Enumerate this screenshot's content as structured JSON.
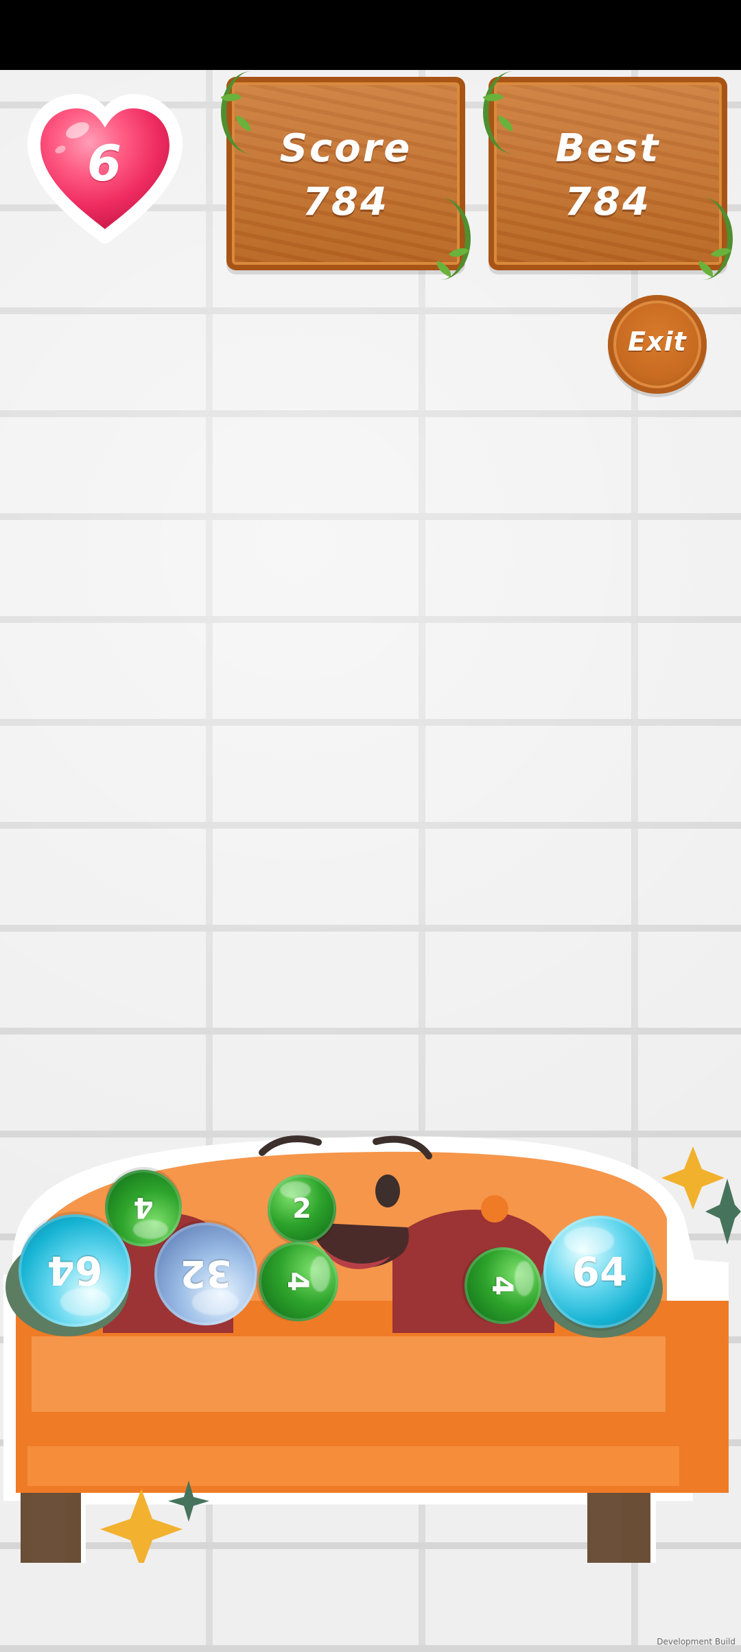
{
  "status_bar": {
    "color": "#000000"
  },
  "hud": {
    "lives": "6",
    "score_label": "Score",
    "score_value": "784",
    "best_label": "Best",
    "best_value": "784",
    "exit_label": "Exit"
  },
  "balls": [
    {
      "value": "4",
      "type": "green",
      "rotation_deg": 180
    },
    {
      "value": "2",
      "type": "green",
      "rotation_deg": 0
    },
    {
      "value": "64",
      "type": "cyan",
      "rotation_deg": 180
    },
    {
      "value": "32",
      "type": "blue",
      "rotation_deg": 180
    },
    {
      "value": "4",
      "type": "green",
      "rotation_deg": 90
    },
    {
      "value": "4",
      "type": "green",
      "rotation_deg": 90
    },
    {
      "value": "64",
      "type": "cyan",
      "rotation_deg": 0
    }
  ],
  "build_label": "Development Build",
  "colors": {
    "heart": "#f0446f",
    "wood": "#c76d24",
    "sofa": "#f6964b",
    "sofa_seat": "#f58128",
    "sofa_mouth": "#9c3334",
    "green_ball": "#2ea42c",
    "blue_ball": "#9bbde6",
    "cyan_ball": "#16b3d3"
  }
}
